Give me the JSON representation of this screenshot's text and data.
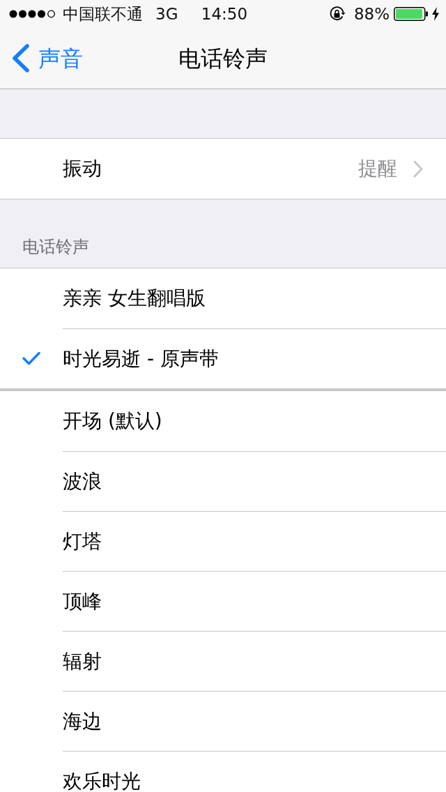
{
  "status_bar": {
    "carrier": "中国联不通",
    "network": "3G",
    "time": "14:50",
    "battery_percent": "88%"
  },
  "nav_bar": {
    "back": "声音",
    "title": "电话铃声"
  },
  "vibration": {
    "label": "振动",
    "value": "提醒"
  },
  "ringtones": {
    "header": "电话铃声",
    "groups": [
      {
        "items": [
          {
            "name": "亲亲 女生翻唱版",
            "selected": false
          },
          {
            "name": "时光易逝 - 原声带",
            "selected": true
          }
        ]
      },
      {
        "items": [
          {
            "name": "开场 (默认)",
            "selected": false
          },
          {
            "name": "波浪",
            "selected": false
          },
          {
            "name": "灯塔",
            "selected": false
          },
          {
            "name": "顶峰",
            "selected": false
          },
          {
            "name": "辐射",
            "selected": false
          },
          {
            "name": "海边",
            "selected": false
          },
          {
            "name": "欢乐时光",
            "selected": false
          }
        ]
      }
    ]
  }
}
